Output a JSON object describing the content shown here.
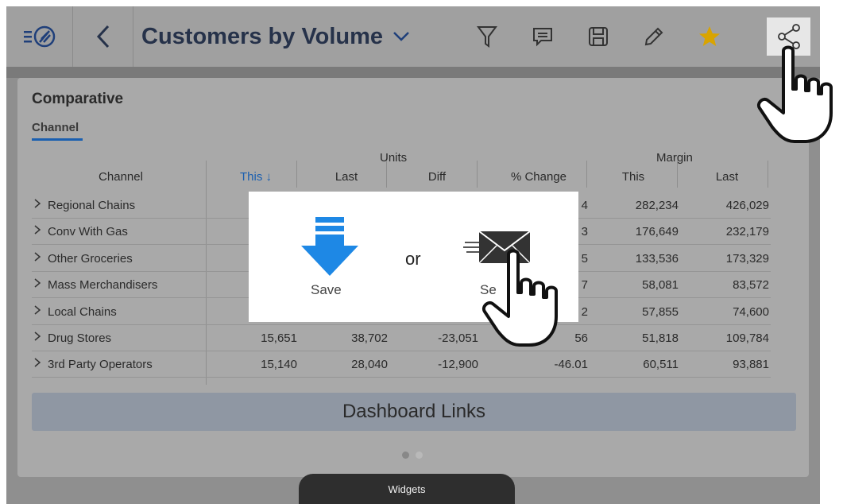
{
  "toolbar": {
    "title": "Customers by Volume",
    "icons": [
      "menu-logo-icon",
      "back-icon",
      "title-dropdown-icon",
      "filter-icon",
      "comment-icon",
      "save-icon",
      "edit-icon",
      "favorite-star-icon",
      "share-icon"
    ]
  },
  "panel": {
    "title": "Comparative",
    "tab": "Channel",
    "groups": {
      "units": "Units",
      "margin": "Margin"
    },
    "columns": {
      "channel": "Channel",
      "this": "This",
      "last": "Last",
      "diff": "Diff",
      "pct_change": "% Change",
      "margin_this": "This",
      "margin_last": "Last"
    },
    "sort_indicator": "↓",
    "rows": [
      {
        "name": "Regional Chains",
        "this": "",
        "last": "",
        "diff": "",
        "pct": "4",
        "m_this": "282,234",
        "m_last": "426,029"
      },
      {
        "name": "Conv With Gas",
        "this": "",
        "last": "",
        "diff": "",
        "pct": "3",
        "m_this": "176,649",
        "m_last": "232,179"
      },
      {
        "name": "Other Groceries",
        "this": "",
        "last": "",
        "diff": "",
        "pct": "5",
        "m_this": "133,536",
        "m_last": "173,329"
      },
      {
        "name": "Mass Merchandisers",
        "this": "",
        "last": "",
        "diff": "",
        "pct": "7",
        "m_this": "58,081",
        "m_last": "83,572"
      },
      {
        "name": "Local Chains",
        "this": "",
        "last": "",
        "diff": "",
        "pct": "2",
        "m_this": "57,855",
        "m_last": "74,600"
      },
      {
        "name": "Drug Stores",
        "this": "15,651",
        "last": "38,702",
        "diff": "-23,051",
        "pct": "56",
        "m_this": "51,818",
        "m_last": "109,784"
      },
      {
        "name": "3rd Party Operators",
        "this": "15,140",
        "last": "28,040",
        "diff": "-12,900",
        "pct": "-46.01",
        "m_this": "60,511",
        "m_last": "93,881"
      }
    ],
    "dashboard_links": "Dashboard Links",
    "page_indicator": {
      "current": 1,
      "total": 2
    }
  },
  "widgets_label": "Widgets",
  "popup": {
    "save_label": "Save",
    "or_label": "or",
    "send_label": "Se"
  },
  "colors": {
    "accent_blue": "#1a5fb0",
    "save_arrow_blue": "#1e88e5",
    "star_gold": "#d9a400"
  }
}
